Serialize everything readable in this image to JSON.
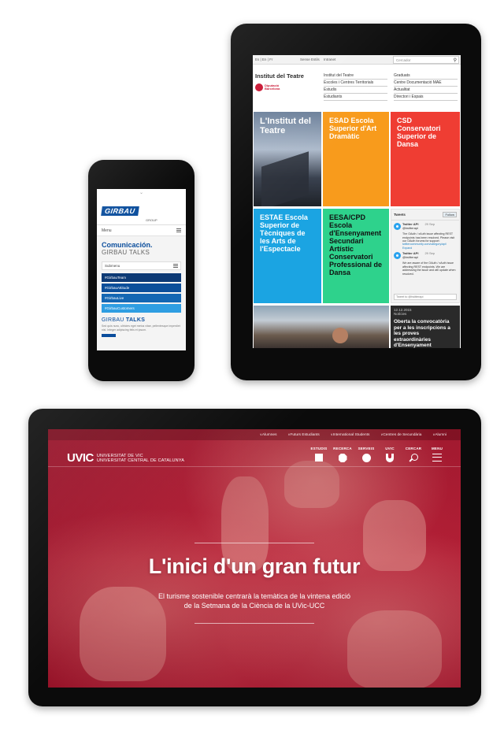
{
  "phone": {
    "top_chevron": "⌄",
    "logo": "GIRBAU",
    "logo_sub": "GROUP",
    "menu_label": "Menu",
    "heading": "Comunicación.",
    "subheading": "GIRBAU TALKS",
    "submenu_label": "Submenu",
    "tags": [
      {
        "label": "#GirbauTeam",
        "color": "#0d3a75"
      },
      {
        "label": "#GirbauAttitude",
        "color": "#0c4f9a"
      },
      {
        "label": "#GirbauLive",
        "color": "#1467b3"
      },
      {
        "label": "#GirbauCustomers",
        "color": "#2f9ee2"
      }
    ],
    "talks_brand": "GIRBAU",
    "talks_word": "TALKS",
    "body_text": "Sed quis nunc, ultricies eget metus vitae, pellentesque imperdiet nisi. Integer adipiscing felis et ipsum."
  },
  "tablet": {
    "lang": "Es | En | Fr",
    "sense_estils": "Sense Estils",
    "intranet": "Intranet",
    "search_placeholder": "Cercador",
    "brand": "Institut del Teatre",
    "diputacio_line1": "Diputació",
    "diputacio_line2": "Barcelona",
    "nav": [
      "Institut del Teatre",
      "Graduats",
      "Escoles i Centres Territorials",
      "Centre Documentació MAE",
      "Estudis",
      "Actualitat",
      "Estudiants",
      "Directori i Espais"
    ],
    "tiles": {
      "photo1": "L'Institut del Teatre",
      "esad": "ESAD Escola Superior d'Art Dramàtic",
      "csd": "CSD Conservatori Superior de Dansa",
      "estae": "ESTAE Escola Superior de Tècniques de les Arts de l'Espectacle",
      "eesa": "EESA/CPD Escola d'Ensenyament Secundari Artístic Conservatori Professional de Dansa"
    },
    "tweets": {
      "title": "Tweets",
      "follow": "Follow",
      "items": [
        {
          "name": "Twitter API",
          "handle": "@twitterapi",
          "date": "29 Sep",
          "text": "The OAuth / xAuth issue affecting REST endpoints has been resolved. Please visit our OAuth forums for support:",
          "link": "twittercommunity.com/category/api/",
          "expand": "Expand"
        },
        {
          "name": "Twitter API",
          "handle": "@twitterapi",
          "date": "29 Sep",
          "text": "We are aware of the OAuth / xAuth issue affecting REST endpoints. We are addressing the issue and will update when resolved.",
          "link": "",
          "expand": ""
        }
      ],
      "input_placeholder": "Tweet to @twitterapi"
    },
    "news": {
      "date": "12.12.2015",
      "category": "Notícies",
      "title": "Oberta la convocatòria per a les inscripcions a les proves extraordinàries d'Ensenyament"
    }
  },
  "laptop": {
    "utility_links": [
      "Alumnes",
      "Futurs Estudiants",
      "International Students",
      "Centres de Secundària",
      "Alumni"
    ],
    "logo_mark": "UVIC",
    "logo_line1": "UNIVERSITAT DE VIC",
    "logo_line2": "UNIVERSITAT CENTRAL DE CATALUNYA",
    "nav": [
      {
        "label": "ESTUDIS",
        "icon": "square-icon"
      },
      {
        "label": "RECERCA",
        "icon": "octagon-icon"
      },
      {
        "label": "SERVEIS",
        "icon": "circle-icon"
      },
      {
        "label": "UVIC",
        "icon": "u-icon"
      },
      {
        "label": "CERCAR",
        "icon": "search-icon"
      },
      {
        "label": "MENU",
        "icon": "menu-icon"
      }
    ],
    "hero_title": "L'inici d'un gran futur",
    "hero_sub_line1": "El turisme sostenible centrarà la temàtica de la vintena edició",
    "hero_sub_line2": "de la Setmana de la Ciència de la UVic-UCC"
  }
}
